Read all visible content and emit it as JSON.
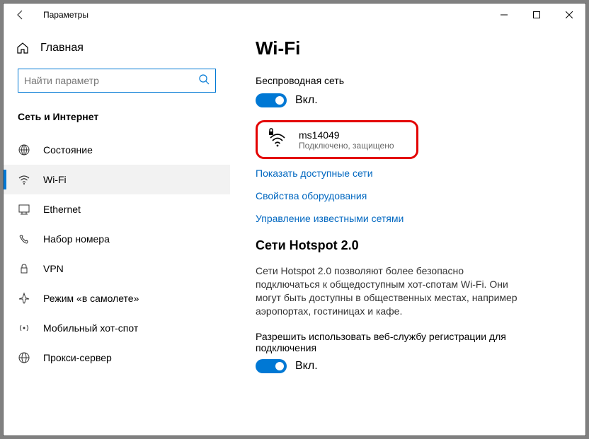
{
  "titlebar": {
    "title": "Параметры"
  },
  "sidebar": {
    "home": "Главная",
    "search_placeholder": "Найти параметр",
    "category": "Сеть и Интернет",
    "items": [
      {
        "label": "Состояние"
      },
      {
        "label": "Wi-Fi"
      },
      {
        "label": "Ethernet"
      },
      {
        "label": "Набор номера"
      },
      {
        "label": "VPN"
      },
      {
        "label": "Режим «в самолете»"
      },
      {
        "label": "Мобильный хот-спот"
      },
      {
        "label": "Прокси-сервер"
      }
    ]
  },
  "main": {
    "title": "Wi-Fi",
    "wireless_label": "Беспроводная сеть",
    "toggle_on": "Вкл.",
    "network": {
      "name": "ms14049",
      "status": "Подключено, защищено"
    },
    "link_show": "Показать доступные сети",
    "link_hardware": "Свойства оборудования",
    "link_known": "Управление известными сетями",
    "hotspot_title": "Сети Hotspot 2.0",
    "hotspot_desc": "Сети Hotspot 2.0 позволяют более безопасно подключаться к общедоступным хот-спотам Wi-Fi. Они могут быть доступны в общественных местах, например аэропортах, гостиницах и кафе.",
    "reg_label": "Разрешить использовать веб-службу регистрации для подключения",
    "reg_toggle": "Вкл."
  }
}
